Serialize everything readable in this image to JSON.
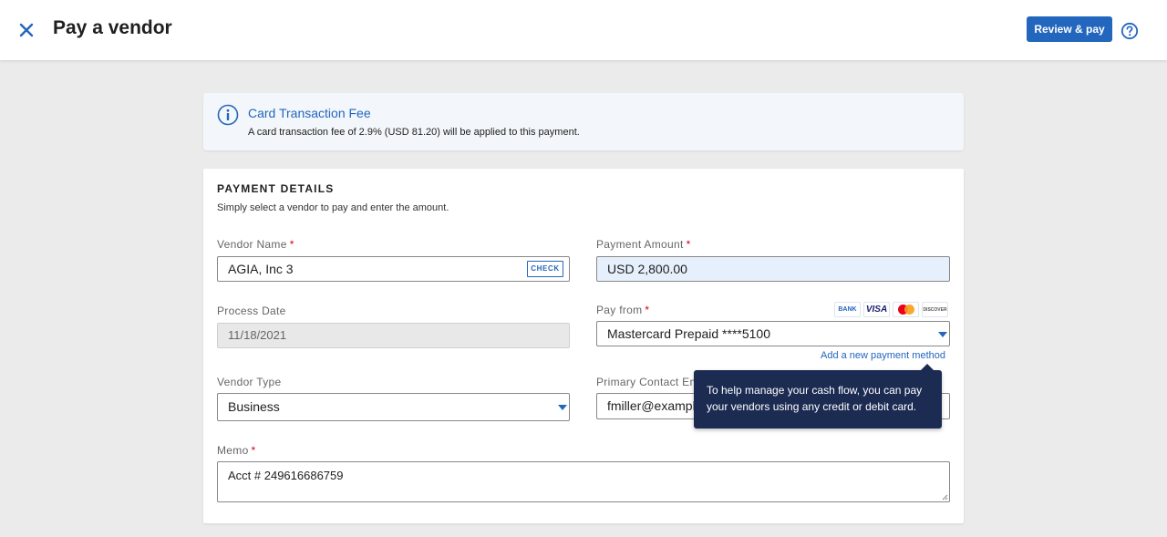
{
  "header": {
    "title": "Pay a vendor",
    "review_button": "Review & pay",
    "close_icon": "close-icon",
    "help_icon": "help-circle-icon"
  },
  "notice": {
    "icon": "info-icon",
    "title": "Card Transaction Fee",
    "text": "A card transaction fee of 2.9% (USD 81.20) will be applied to this payment."
  },
  "payment_details": {
    "title": "PAYMENT DETAILS",
    "subtitle": "Simply select a vendor to pay and enter the amount.",
    "required_marker": "*",
    "vendor_name": {
      "label": "Vendor Name",
      "value": "AGIA, Inc 3",
      "check_button": "CHECK"
    },
    "payment_amount": {
      "label": "Payment Amount",
      "value": "USD 2,800.00"
    },
    "process_date": {
      "label": "Process Date",
      "value": "11/18/2021"
    },
    "pay_from": {
      "label": "Pay from",
      "value": "Mastercard Prepaid ****5100",
      "methods": [
        "BANK",
        "VISA",
        "Mastercard",
        "DISCOVER"
      ],
      "add_link": "Add a new payment method"
    },
    "vendor_type": {
      "label": "Vendor Type",
      "value": "Business"
    },
    "primary_contact_email": {
      "label": "Primary Contact Email",
      "value": "fmiller@example.com"
    },
    "memo": {
      "label": "Memo",
      "value": "Acct # 249616686759"
    }
  },
  "tooltip": {
    "text": "To help manage your cash flow, you can pay your vendors using any credit or debit card."
  },
  "colors": {
    "accent": "#2366bd",
    "tooltip_bg": "#1b2b52",
    "required": "#d0021b",
    "highlight_field": "#e6f0fc"
  }
}
